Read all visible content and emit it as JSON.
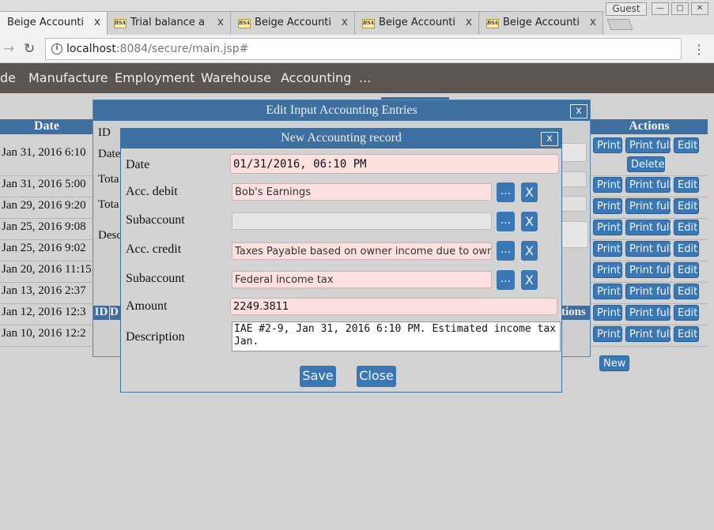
{
  "browser": {
    "tabs": [
      {
        "favicon": "BSA",
        "title": "Beige Accounti"
      },
      {
        "favicon": "BSA",
        "title": "Trial balance a"
      },
      {
        "favicon": "BSA",
        "title": "Beige Accounti"
      },
      {
        "favicon": "BSA",
        "title": "Beige Accounti"
      },
      {
        "favicon": "BSA",
        "title": "Beige Accounti"
      }
    ],
    "tab_close": "x",
    "profile": "Guest",
    "url_host": "localhost",
    "url_rest": ":8084/secure/main.jsp#"
  },
  "menu": {
    "items": [
      "de",
      "Manufacture",
      "Employment",
      "Warehouse",
      "Accounting",
      "..."
    ]
  },
  "background": {
    "date_header": "Date",
    "actions_header": "Actions",
    "sub_headers": {
      "id": "ID",
      "d": "D",
      "tions": "tions"
    },
    "rows": [
      "Jan 31, 2016 6:10",
      "Jan 31, 2016 5:00",
      "Jan 29, 2016 9:20",
      "Jan 25, 2016 9:08",
      "Jan 25, 2016 9:02",
      "Jan 20, 2016 11:15",
      "Jan 13, 2016 2:37",
      "Jan 12, 2016 12:3",
      "Jan 10, 2016 12:2"
    ],
    "btn_print": "Print",
    "btn_print_full": "Print full",
    "btn_edit": "Edit",
    "btn_delete": "Delete",
    "btn_new": "New"
  },
  "outer_dialog": {
    "title": "Edit Input Accounting Entries",
    "close": "x",
    "labels": [
      "ID",
      "Date",
      "Tota",
      "Tota",
      "Desc"
    ]
  },
  "record_dialog": {
    "title": "New Accounting record",
    "close": "x",
    "labels": {
      "date": "Date",
      "acc_debit": "Acc. debit",
      "sub_debit": "Subaccount",
      "acc_credit": "Acc. credit",
      "sub_credit": "Subaccount",
      "amount": "Amount",
      "description": "Description"
    },
    "values": {
      "date": "01/31/2016, 06:10 PM",
      "acc_debit": "Bob's Earnings",
      "sub_debit": "",
      "acc_credit": "Taxes Payable based on owner income due to owner",
      "sub_credit": "Federal income tax",
      "amount": "2249.3811",
      "description": "IAE #2-9, Jan 31, 2016 6:10 PM. Estimated income tax Jan."
    },
    "pick_label": "...",
    "clear_label": "X",
    "save": "Save",
    "close_btn": "Close"
  }
}
